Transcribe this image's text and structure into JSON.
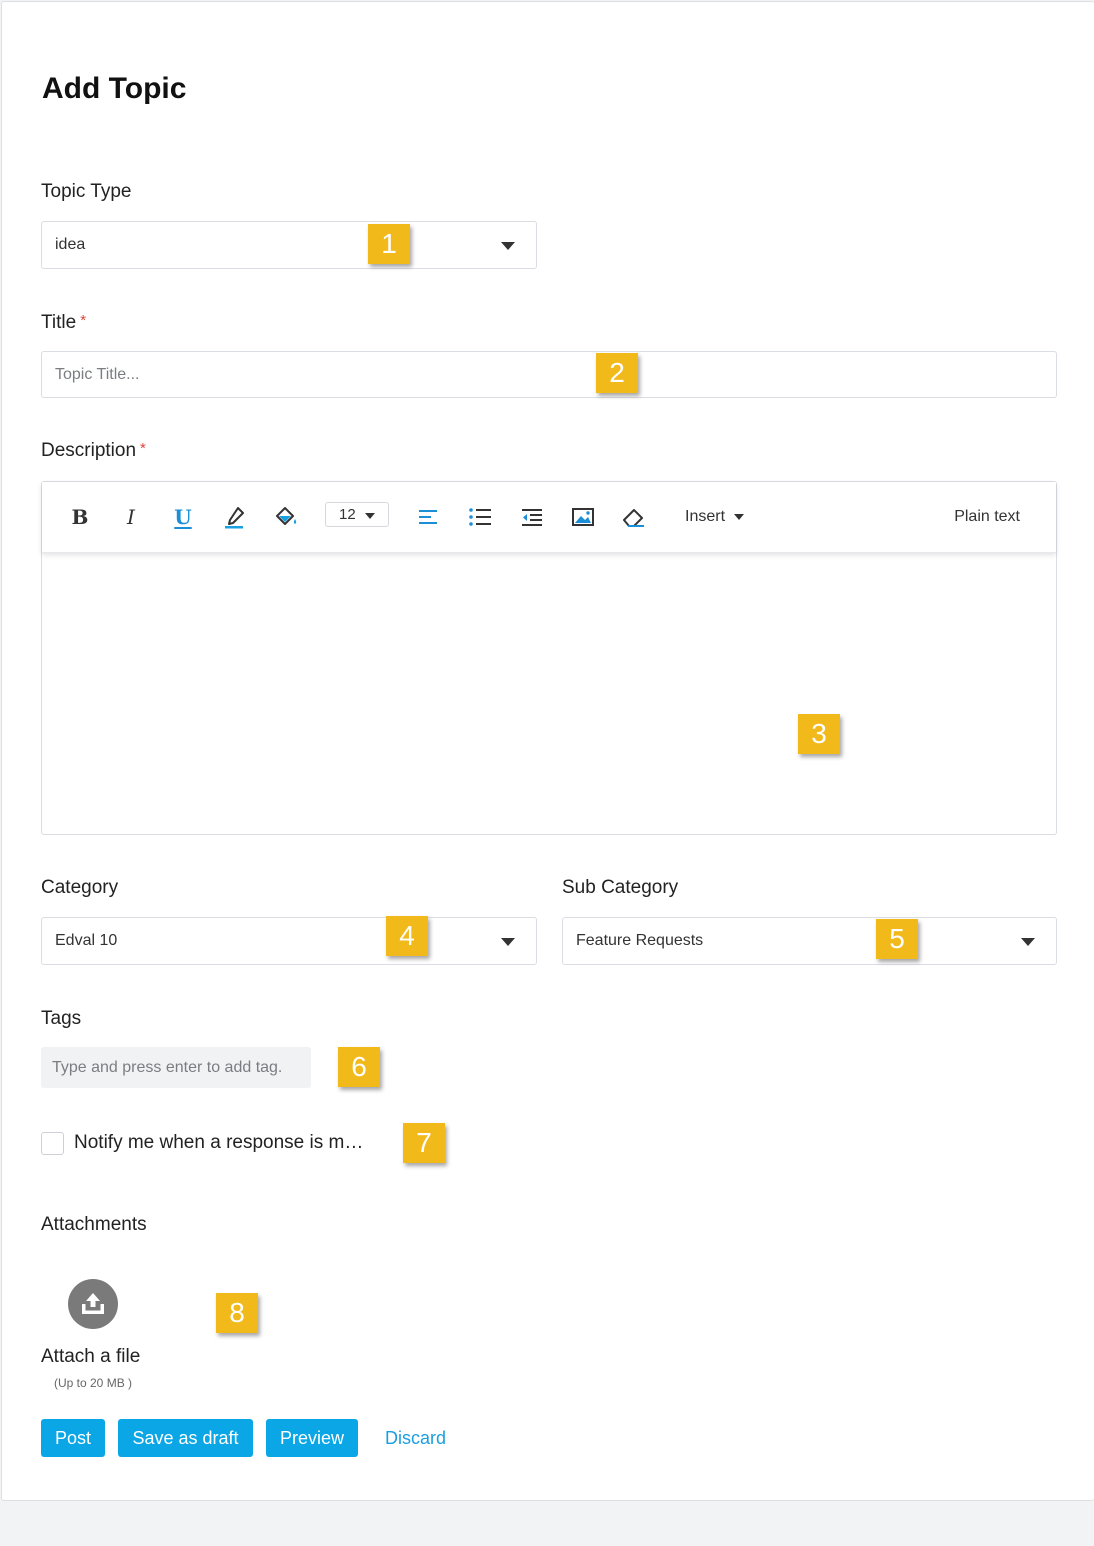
{
  "page": {
    "title": "Add Topic"
  },
  "topic_type": {
    "label": "Topic Type",
    "value": "idea"
  },
  "title_field": {
    "label": "Title",
    "required_mark": "*",
    "placeholder": "Topic Title..."
  },
  "description": {
    "label": "Description",
    "required_mark": "*",
    "toolbar": {
      "bold": "B",
      "italic": "I",
      "underline": "U",
      "font_size": "12",
      "insert_label": "Insert",
      "plain_text_label": "Plain text"
    },
    "body": ""
  },
  "category": {
    "label": "Category",
    "value": "Edval 10"
  },
  "sub_category": {
    "label": "Sub Category",
    "value": "Feature Requests"
  },
  "tags": {
    "label": "Tags",
    "placeholder": "Type and press enter to add tag."
  },
  "notify": {
    "label": "Notify me when a response is m…",
    "checked": false
  },
  "attachments": {
    "label": "Attachments",
    "attach_label": "Attach a file",
    "size_hint": "(Up to 20 MB )"
  },
  "actions": {
    "post": "Post",
    "save_draft": "Save as draft",
    "preview": "Preview",
    "discard": "Discard"
  },
  "markers": [
    "1",
    "2",
    "3",
    "4",
    "5",
    "6",
    "7",
    "8"
  ],
  "colors": {
    "primary": "#0aa6e6",
    "marker": "#f2b91b",
    "required": "#e0463c",
    "link": "#1a9fe0"
  }
}
